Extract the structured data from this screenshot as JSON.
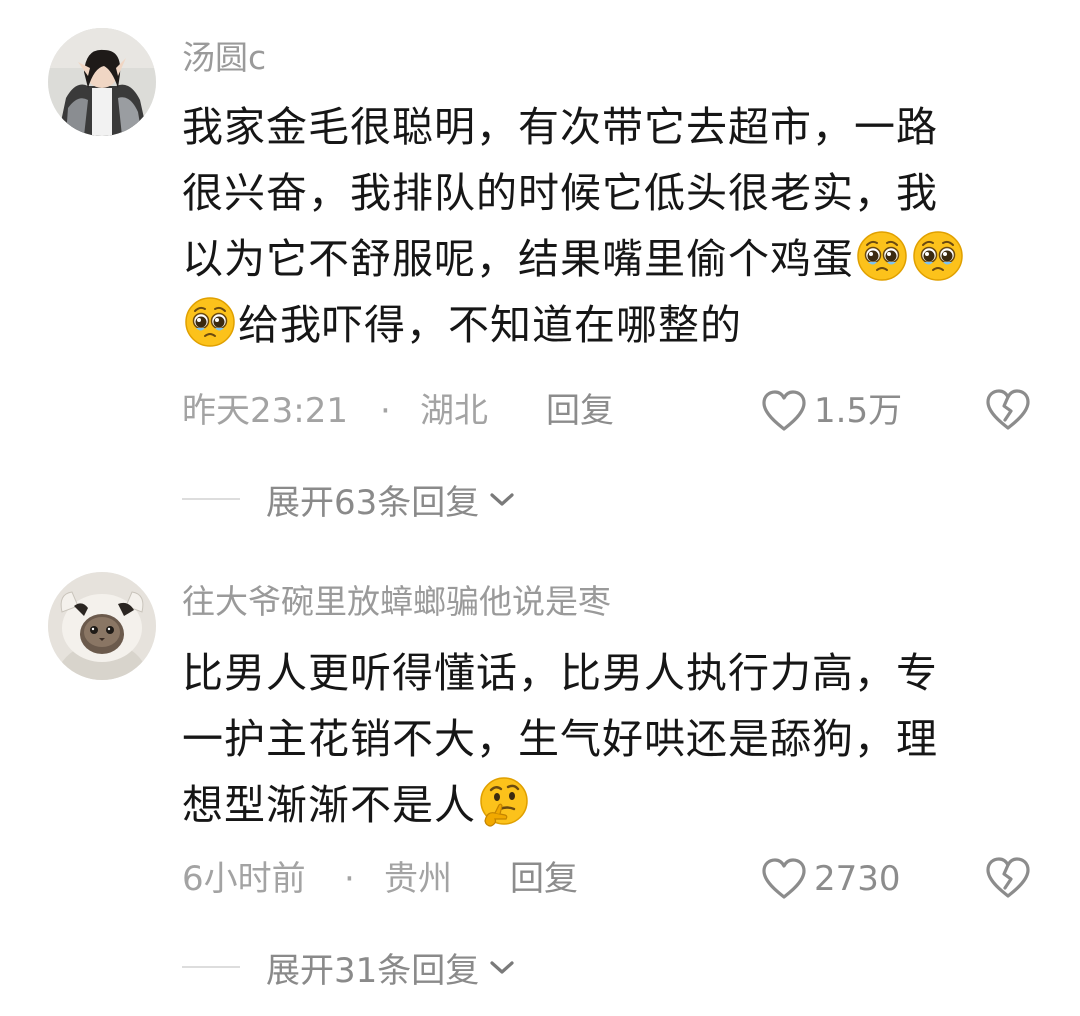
{
  "comments": [
    {
      "username": "汤圆c",
      "lines": [
        "我家金毛很聪明，有次带它去超市，一路",
        "很兴奋，我排队的时候它低头很老实，我",
        "以为它不舒服呢，结果嘴里偷个鸡蛋",
        "给我吓得，不知道在哪整的"
      ],
      "emoji_icon": "pleading-face-icon",
      "time": "昨天23:21",
      "dot": "·",
      "location": "湖北",
      "reply_label": "回复",
      "likes": "1.5万",
      "expand_label": "展开63条回复"
    },
    {
      "username": "往大爷碗里放蟑螂骗他说是枣",
      "lines": [
        "比男人更听得懂话，比男人执行力高，专",
        "一护主花销不大，生气好哄还是舔狗，理",
        "想型渐渐不是人"
      ],
      "emoji_icon": "thinking-face-icon",
      "time": "6小时前",
      "dot": "·",
      "location": "贵州",
      "reply_label": "回复",
      "likes": "2730",
      "expand_label": "展开31条回复"
    }
  ],
  "colors": {
    "text": "#161616",
    "muted": "#9a9a9a",
    "emoji_yellow": "#fcc21b"
  }
}
